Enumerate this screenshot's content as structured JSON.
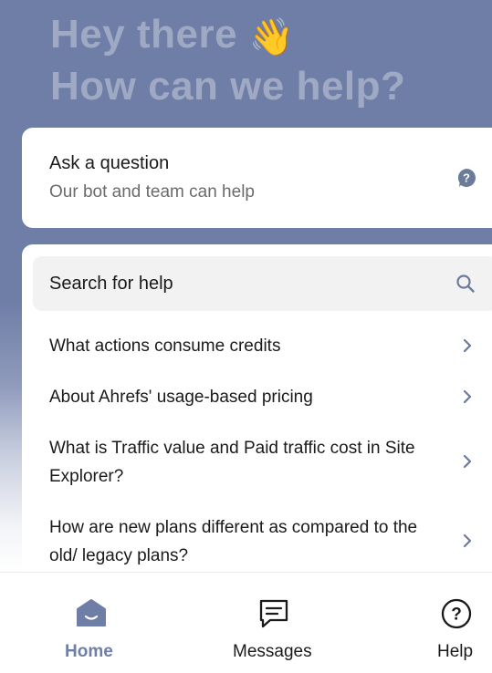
{
  "header": {
    "line1": "Hey there",
    "wave_emoji": "👋",
    "line2": "How can we help?"
  },
  "ask_card": {
    "title": "Ask a question",
    "subtitle": "Our bot and team can help",
    "icon": "question-bubble-icon"
  },
  "help_card": {
    "search_label": "Search for help",
    "articles": [
      {
        "title": "What actions consume credits"
      },
      {
        "title": "About Ahrefs' usage-based pricing"
      },
      {
        "title": "What is Traffic value and Paid traffic cost in Site Explorer?"
      },
      {
        "title": "How are new plans different as compared to the old/ legacy plans?"
      }
    ]
  },
  "nav": {
    "items": [
      {
        "label": "Home",
        "icon": "home-icon",
        "active": true
      },
      {
        "label": "Messages",
        "icon": "messages-icon",
        "active": false
      },
      {
        "label": "Help",
        "icon": "help-icon",
        "active": false
      }
    ]
  },
  "colors": {
    "header_bg": "#6f7ea7",
    "header_text": "#9fa9c4",
    "active_nav": "#6f7ea7",
    "icon_grey": "#6c7b98",
    "text_dark": "#1a1a1a",
    "text_muted": "#6b6b6b"
  }
}
